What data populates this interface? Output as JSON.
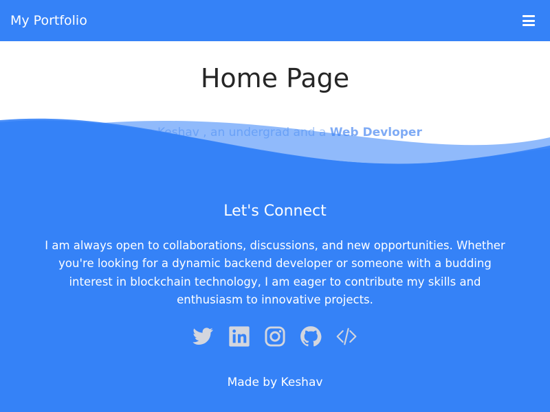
{
  "navbar": {
    "brand": "My Portfolio",
    "menu_icon": "hamburger-menu-icon",
    "background": "#3582f7"
  },
  "hero": {
    "title": "Home Page",
    "intro_prefix": "I am Keshav , an undergrad and a ",
    "intro_highlight": "Web Devloper"
  },
  "connect": {
    "title": "Let's Connect",
    "text": "I am always open to collaborations, discussions, and new opportunities. Whether you're looking for a dynamic backend developer or someone with a budding interest in blockchain technology, I am eager to contribute my skills and enthusiasm to innovative projects."
  },
  "socials": [
    "twitter-icon",
    "linkedin-icon",
    "instagram-icon",
    "github-icon",
    "code-icon"
  ],
  "footer": {
    "text": "Made by Keshav"
  },
  "colors": {
    "accent": "#3582f7",
    "title_text": "#262626",
    "icon_gray": "#d3d6de"
  }
}
